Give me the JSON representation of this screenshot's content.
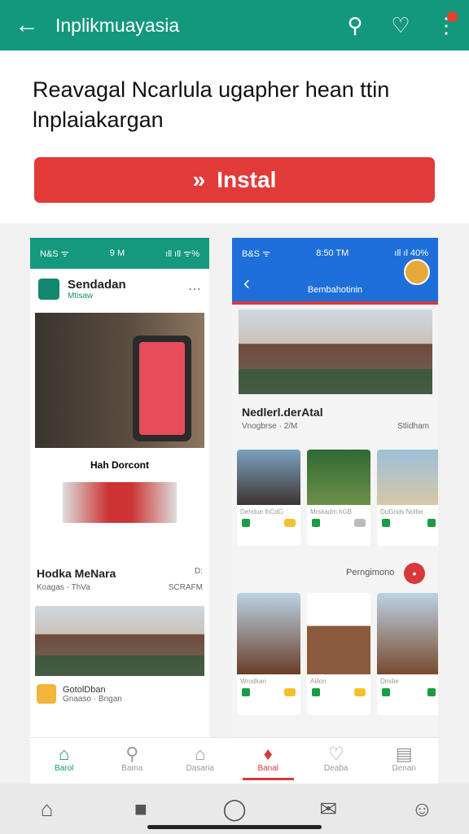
{
  "topbar": {
    "title": "Inplikmuayasia",
    "back_icon": "arrow-left-icon",
    "search_icon": "search-icon",
    "heart_icon": "heart-icon",
    "menu_icon": "more-vert-icon",
    "accent": "#13987d"
  },
  "headline": "Reavagal Ncarlula ugapher hean ttin lnplaiakargan",
  "install": {
    "label": "Instal",
    "color": "#e23a38"
  },
  "left_phone": {
    "status_left": "N&S ᯤ",
    "status_mid": "9 M",
    "status_right": "ıll ıll ᯤ%",
    "app_name": "Sendadan",
    "app_sub": "Mtisaw",
    "banner_title": "Hah Dorcont",
    "card_title": "Hodka MeNara",
    "card_right": "D:",
    "card_sub": "Koagas - ThVa",
    "card_sub_right": "SCRAFM",
    "bottom_title": "GotolDban",
    "bottom_sub": "Gnaaso · Bngan"
  },
  "right_phone": {
    "status_left": "B&S ᯤ",
    "status_mid": "8:50 TM",
    "status_right": "ıll ıl 40%",
    "header": "Bembahotinin",
    "card_title": "Nedlerl.derAtal",
    "card_sub": "Vnogbrse · 2/M",
    "card_right": "Stlidham",
    "tiles_row1_meta": [
      "Dehdue lhCdG",
      "Mrskadm hGB",
      "DuGnds Nolbe"
    ],
    "section_label": "Perngimono",
    "tiles_row2_meta": [
      "Wrodkan",
      "Alilon",
      "Dindie"
    ]
  },
  "inner_nav": [
    {
      "label": "Barol",
      "icon": "home-icon"
    },
    {
      "label": "Bama",
      "icon": "search-icon"
    },
    {
      "label": "Dasaria",
      "icon": "house-outline-icon"
    },
    {
      "label": "Banal",
      "icon": "bookmark-icon"
    },
    {
      "label": "Deaba",
      "icon": "heart-outline-icon"
    },
    {
      "label": "Denan",
      "icon": "list-icon"
    }
  ],
  "system_nav": [
    "home-outline-icon",
    "chat-icon",
    "circle-icon",
    "mail-icon",
    "person-icon"
  ]
}
